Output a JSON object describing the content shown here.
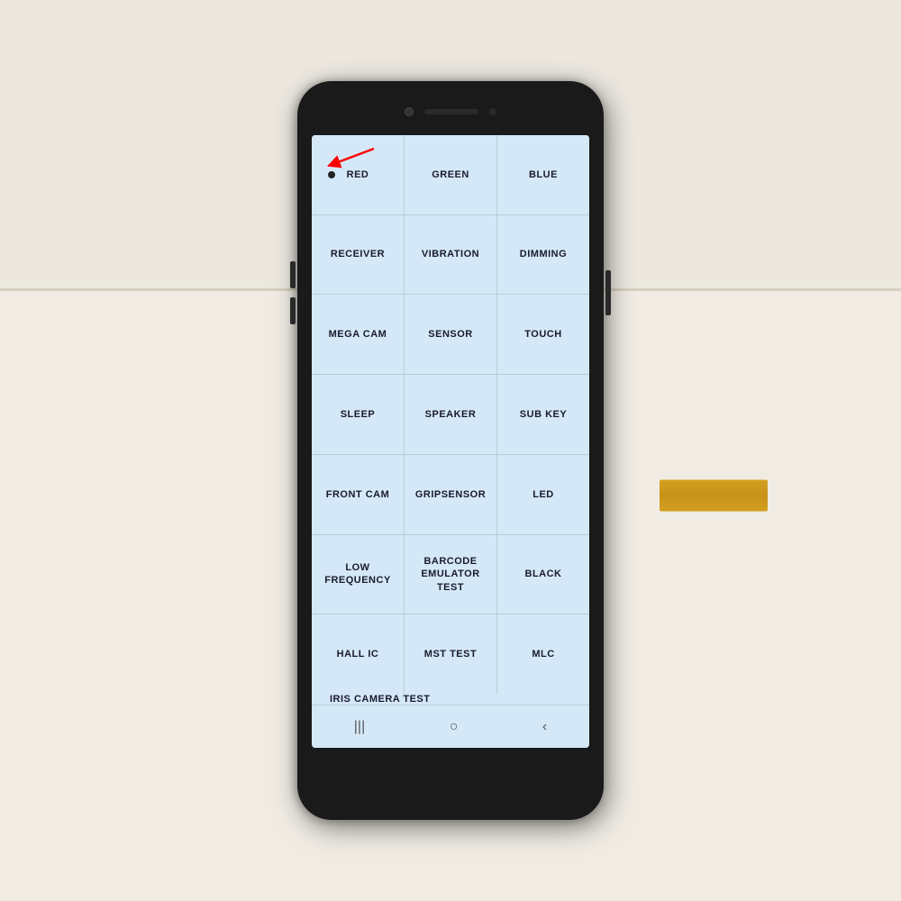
{
  "scene": {
    "background": "#e8e0d0"
  },
  "phone": {
    "grid": {
      "rows": [
        [
          {
            "id": "red",
            "label": "RED",
            "hasArrow": true
          },
          {
            "id": "green",
            "label": "GREEN",
            "hasArrow": false
          },
          {
            "id": "blue",
            "label": "BLUE",
            "hasArrow": false
          }
        ],
        [
          {
            "id": "receiver",
            "label": "RECEIVER",
            "hasArrow": false
          },
          {
            "id": "vibration",
            "label": "VIBRATION",
            "hasArrow": false
          },
          {
            "id": "dimming",
            "label": "DIMMING",
            "hasArrow": false
          }
        ],
        [
          {
            "id": "mega-cam",
            "label": "MEGA CAM",
            "hasArrow": false
          },
          {
            "id": "sensor",
            "label": "SENSOR",
            "hasArrow": false
          },
          {
            "id": "touch",
            "label": "TOUCH",
            "hasArrow": false
          }
        ],
        [
          {
            "id": "sleep",
            "label": "SLEEP",
            "hasArrow": false
          },
          {
            "id": "speaker",
            "label": "SPEAKER",
            "hasArrow": false
          },
          {
            "id": "sub-key",
            "label": "SUB KEY",
            "hasArrow": false
          }
        ],
        [
          {
            "id": "front-cam",
            "label": "FRONT CAM",
            "hasArrow": false
          },
          {
            "id": "gripsensor",
            "label": "GRIPSENSOR",
            "hasArrow": false
          },
          {
            "id": "led",
            "label": "LED",
            "hasArrow": false
          }
        ],
        [
          {
            "id": "low-frequency",
            "label": "LOW FREQUENCY",
            "hasArrow": false
          },
          {
            "id": "barcode-emulator-test",
            "label": "BARCODE EMULATOR TEST",
            "hasArrow": false
          },
          {
            "id": "black",
            "label": "BLACK",
            "hasArrow": false
          }
        ],
        [
          {
            "id": "hall-ic",
            "label": "HALL IC",
            "hasArrow": false
          },
          {
            "id": "mst-test",
            "label": "MST TEST",
            "hasArrow": false
          },
          {
            "id": "mlc",
            "label": "MLC",
            "hasArrow": false
          }
        ]
      ],
      "bottom_row": {
        "id": "iris-camera-test",
        "label": "IRIS CAMERA TEST"
      }
    },
    "nav": {
      "left_icon": "|||",
      "center_icon": "○",
      "right_icon": "‹"
    }
  }
}
